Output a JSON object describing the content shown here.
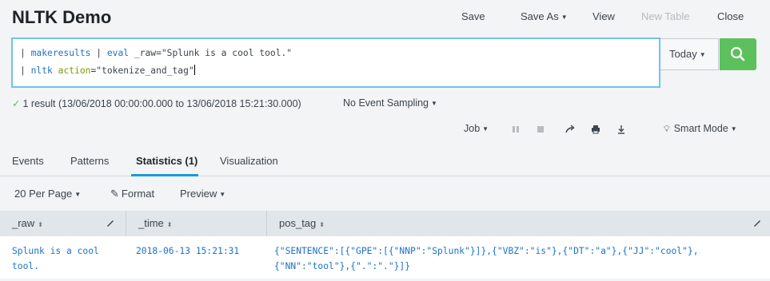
{
  "app": {
    "title": "NLTK Demo"
  },
  "header_actions": [
    {
      "label": "Save",
      "enabled": true,
      "dropdown": false
    },
    {
      "label": "Save As",
      "enabled": true,
      "dropdown": true
    },
    {
      "label": "View",
      "enabled": true,
      "dropdown": false
    },
    {
      "label": "New Table",
      "enabled": false,
      "dropdown": false
    },
    {
      "label": "Close",
      "enabled": true,
      "dropdown": false
    }
  ],
  "search": {
    "line1": {
      "pipe": "| ",
      "cmd1": "makeresults",
      "sep": " | ",
      "cmd2": "eval",
      "rest": " _raw=\"Splunk is a cool tool.\""
    },
    "line2": {
      "pipe": "| ",
      "cmd": "nltk",
      "sp": " ",
      "arg": "action",
      "rest": "=\"tokenize_and_tag\""
    }
  },
  "time_picker": {
    "label": "Today"
  },
  "status": {
    "result": "1 result (13/06/2018 00:00:00.000 to 13/06/2018 15:21:30.000)",
    "sampling": "No Event Sampling"
  },
  "job": {
    "label": "Job",
    "mode": "Smart Mode"
  },
  "tabs": [
    {
      "label": "Events",
      "active": false
    },
    {
      "label": "Patterns",
      "active": false
    },
    {
      "label": "Statistics (1)",
      "active": true
    },
    {
      "label": "Visualization",
      "active": false
    }
  ],
  "table_toolbar": {
    "per_page": "20 Per Page",
    "format": "Format",
    "preview": "Preview"
  },
  "table": {
    "columns": [
      "_raw",
      "_time",
      "pos_tag"
    ],
    "rows": [
      {
        "raw": "Splunk is a cool\ntool.",
        "time": "2018-06-13 15:21:31",
        "pos_tag": "{\"SENTENCE\":[{\"GPE\":[{\"NNP\":\"Splunk\"}]},{\"VBZ\":\"is\"},{\"DT\":\"a\"},{\"JJ\":\"cool\"},\n{\"NN\":\"tool\"},{\".\":\".\"}]}"
      }
    ]
  },
  "colors": {
    "accent_blue": "#1a73c9",
    "search_green": "#5cc05c",
    "tab_underline": "#1a9ad6",
    "arg_green": "#7a9a01"
  }
}
